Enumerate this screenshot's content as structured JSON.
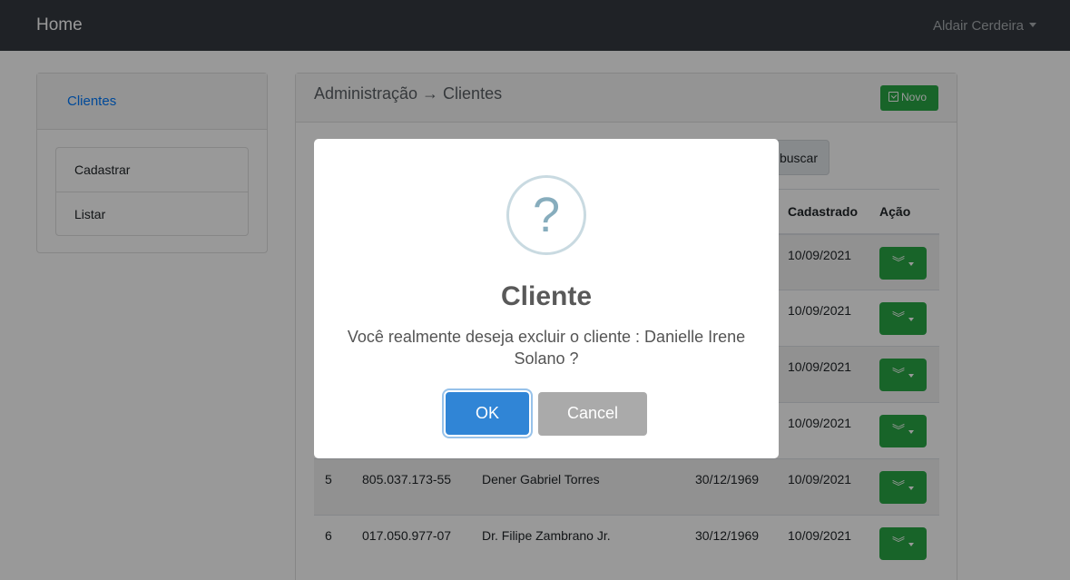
{
  "navbar": {
    "brand": "Home",
    "user": "Aldair Cerdeira"
  },
  "sidebar": {
    "header": "Clientes",
    "items": [
      {
        "label": "Cadastrar"
      },
      {
        "label": "Listar"
      }
    ]
  },
  "card": {
    "breadcrumb": "Administração → Clientes",
    "new_label": "Novo",
    "search_label": "buscar"
  },
  "table": {
    "columns": [
      "",
      "",
      "",
      "",
      "Cadastrado",
      "Ação"
    ],
    "rows": [
      {
        "id": "",
        "cpf": "",
        "name": "",
        "birth": "",
        "created": "10/09/2021"
      },
      {
        "id": "",
        "cpf": "",
        "name": "",
        "birth": "",
        "created": "10/09/2021"
      },
      {
        "id": "",
        "cpf": "",
        "name": "",
        "birth": "",
        "created": "10/09/2021"
      },
      {
        "id": "",
        "cpf": "",
        "name": "",
        "birth": "",
        "created": "10/09/2021"
      },
      {
        "id": "5",
        "cpf": "805.037.173-55",
        "name": "Dener Gabriel Torres",
        "birth": "30/12/1969",
        "created": "10/09/2021"
      },
      {
        "id": "6",
        "cpf": "017.050.977-07",
        "name": "Dr. Filipe Zambrano Jr.",
        "birth": "30/12/1969",
        "created": "10/09/2021"
      }
    ]
  },
  "modal": {
    "icon": "?",
    "title": "Cliente",
    "text": "Você realmente deseja excluir o cliente : Danielle Irene Solano ?",
    "ok_label": "OK",
    "cancel_label": "Cancel"
  }
}
